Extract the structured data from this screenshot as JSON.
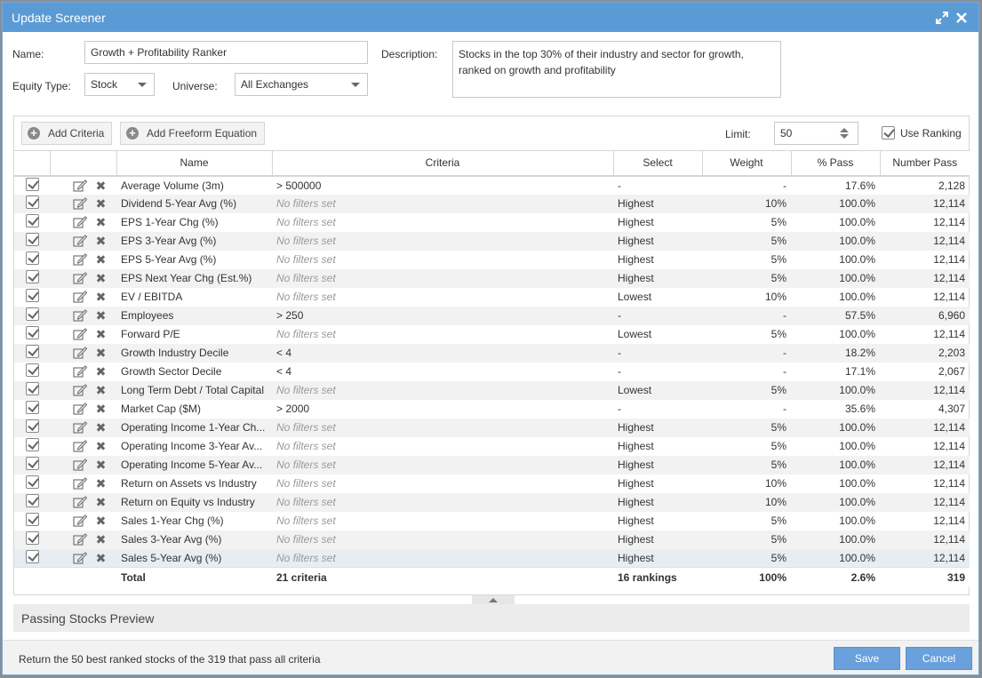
{
  "dialog": {
    "title": "Update Screener"
  },
  "form": {
    "name_label": "Name:",
    "name_value": "Growth + Profitability Ranker",
    "description_label": "Description:",
    "description_value": "Stocks in the top 30% of their industry and sector for growth, ranked on growth and profitability",
    "equity_type_label": "Equity Type:",
    "equity_type_value": "Stock",
    "universe_label": "Universe:",
    "universe_value": "All Exchanges"
  },
  "toolbar": {
    "add_criteria": "Add Criteria",
    "add_freeform": "Add Freeform Equation",
    "limit_label": "Limit:",
    "limit_value": "50",
    "use_ranking": "Use Ranking"
  },
  "table": {
    "headers": {
      "name": "Name",
      "criteria": "Criteria",
      "select": "Select",
      "weight": "Weight",
      "pct_pass": "% Pass",
      "number_pass": "Number Pass"
    },
    "rows": [
      {
        "name": "Average Volume (3m)",
        "criteria": "> 500000",
        "select": "-",
        "weight": "-",
        "pct": "17.6%",
        "num": "2,128"
      },
      {
        "name": "Dividend 5-Year Avg (%)",
        "criteria": "No filters set",
        "select": "Highest",
        "weight": "10%",
        "pct": "100.0%",
        "num": "12,114"
      },
      {
        "name": "EPS 1-Year Chg (%)",
        "criteria": "No filters set",
        "select": "Highest",
        "weight": "5%",
        "pct": "100.0%",
        "num": "12,114"
      },
      {
        "name": "EPS 3-Year Avg (%)",
        "criteria": "No filters set",
        "select": "Highest",
        "weight": "5%",
        "pct": "100.0%",
        "num": "12,114"
      },
      {
        "name": "EPS 5-Year Avg (%)",
        "criteria": "No filters set",
        "select": "Highest",
        "weight": "5%",
        "pct": "100.0%",
        "num": "12,114"
      },
      {
        "name": "EPS Next Year Chg (Est.%)",
        "criteria": "No filters set",
        "select": "Highest",
        "weight": "5%",
        "pct": "100.0%",
        "num": "12,114"
      },
      {
        "name": "EV / EBITDA",
        "criteria": "No filters set",
        "select": "Lowest",
        "weight": "10%",
        "pct": "100.0%",
        "num": "12,114"
      },
      {
        "name": "Employees",
        "criteria": "> 250",
        "select": "-",
        "weight": "-",
        "pct": "57.5%",
        "num": "6,960"
      },
      {
        "name": "Forward P/E",
        "criteria": "No filters set",
        "select": "Lowest",
        "weight": "5%",
        "pct": "100.0%",
        "num": "12,114"
      },
      {
        "name": "Growth Industry Decile",
        "criteria": "< 4",
        "select": "-",
        "weight": "-",
        "pct": "18.2%",
        "num": "2,203"
      },
      {
        "name": "Growth Sector Decile",
        "criteria": "< 4",
        "select": "-",
        "weight": "-",
        "pct": "17.1%",
        "num": "2,067"
      },
      {
        "name": "Long Term Debt / Total Capital",
        "criteria": "No filters set",
        "select": "Lowest",
        "weight": "5%",
        "pct": "100.0%",
        "num": "12,114"
      },
      {
        "name": "Market Cap ($M)",
        "criteria": "> 2000",
        "select": "-",
        "weight": "-",
        "pct": "35.6%",
        "num": "4,307"
      },
      {
        "name": "Operating Income 1-Year Ch...",
        "criteria": "No filters set",
        "select": "Highest",
        "weight": "5%",
        "pct": "100.0%",
        "num": "12,114"
      },
      {
        "name": "Operating Income 3-Year Av...",
        "criteria": "No filters set",
        "select": "Highest",
        "weight": "5%",
        "pct": "100.0%",
        "num": "12,114"
      },
      {
        "name": "Operating Income 5-Year Av...",
        "criteria": "No filters set",
        "select": "Highest",
        "weight": "5%",
        "pct": "100.0%",
        "num": "12,114"
      },
      {
        "name": "Return on Assets vs Industry",
        "criteria": "No filters set",
        "select": "Highest",
        "weight": "10%",
        "pct": "100.0%",
        "num": "12,114"
      },
      {
        "name": "Return on Equity vs Industry",
        "criteria": "No filters set",
        "select": "Highest",
        "weight": "10%",
        "pct": "100.0%",
        "num": "12,114"
      },
      {
        "name": "Sales 1-Year Chg (%)",
        "criteria": "No filters set",
        "select": "Highest",
        "weight": "5%",
        "pct": "100.0%",
        "num": "12,114"
      },
      {
        "name": "Sales 3-Year Avg (%)",
        "criteria": "No filters set",
        "select": "Highest",
        "weight": "5%",
        "pct": "100.0%",
        "num": "12,114"
      },
      {
        "name": "Sales 5-Year Avg (%)",
        "criteria": "No filters set",
        "select": "Highest",
        "weight": "5%",
        "pct": "100.0%",
        "num": "12,114"
      }
    ],
    "total": {
      "name": "Total",
      "criteria": "21 criteria",
      "select": "16 rankings",
      "weight": "100%",
      "pct": "2.6%",
      "num": "319"
    }
  },
  "preview": {
    "label": "Passing Stocks Preview"
  },
  "footer": {
    "message": "Return the 50 best ranked stocks of the 319 that pass all criteria",
    "save": "Save",
    "cancel": "Cancel"
  },
  "colors": {
    "titlebar": "#5b9bd5",
    "button": "#6aa0dc"
  }
}
